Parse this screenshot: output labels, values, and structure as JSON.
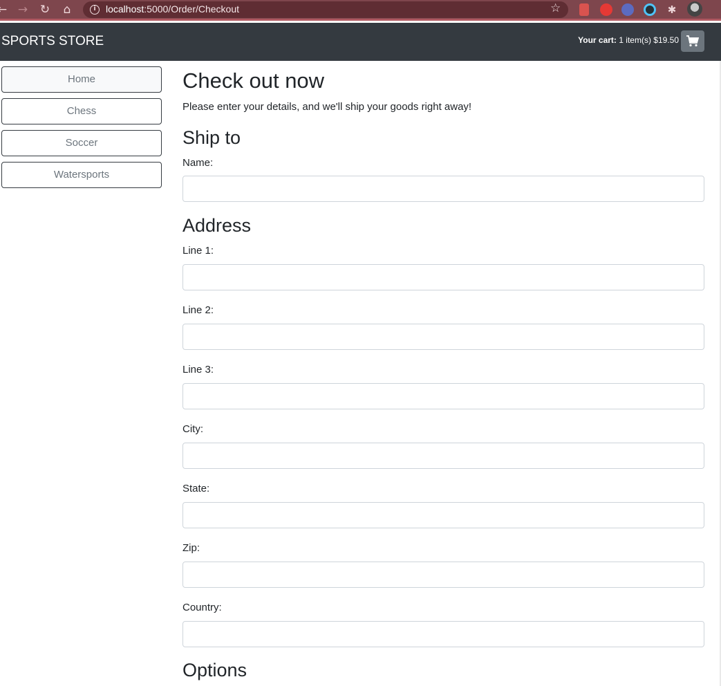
{
  "browser": {
    "url_host": "localhost",
    "url_rest": ":5000/Order/Checkout"
  },
  "navbar": {
    "brand": "SPORTS STORE",
    "cart_label": "Your cart:",
    "cart_summary": "1 item(s) $19.50"
  },
  "sidebar": {
    "items": [
      {
        "label": "Home"
      },
      {
        "label": "Chess"
      },
      {
        "label": "Soccer"
      },
      {
        "label": "Watersports"
      }
    ]
  },
  "main": {
    "title": "Check out now",
    "subtitle": "Please enter your details, and we'll ship your goods right away!",
    "ship_to": "Ship to",
    "name_label": "Name:",
    "address": "Address",
    "line1_label": "Line 1:",
    "line2_label": "Line 2:",
    "line3_label": "Line 3:",
    "city_label": "City:",
    "state_label": "State:",
    "zip_label": "Zip:",
    "country_label": "Country:",
    "options": "Options"
  }
}
